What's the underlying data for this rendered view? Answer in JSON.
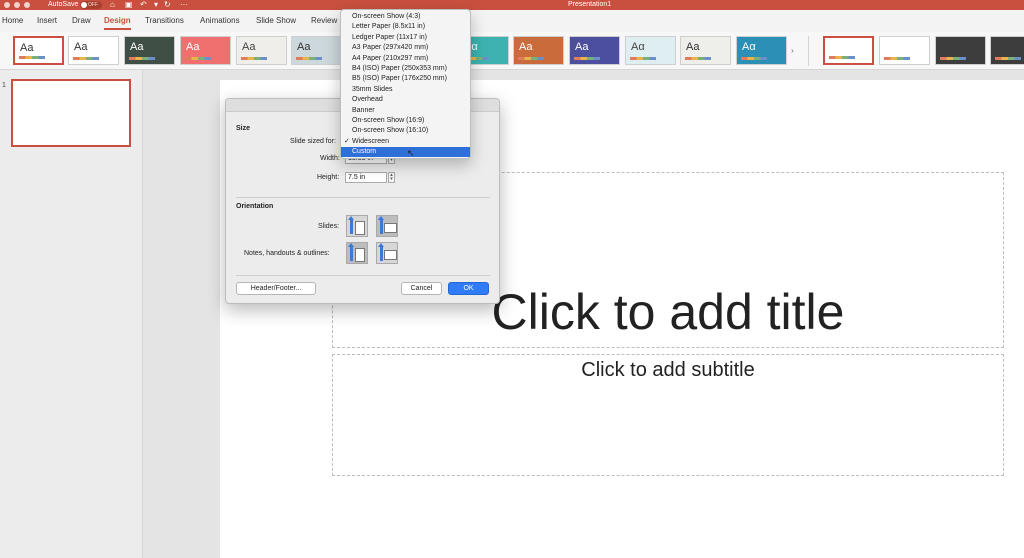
{
  "titlebar": {
    "autosave_label": "AutoSave",
    "autosave_state": "OFF",
    "doc_title": "Presentation1",
    "icons": [
      "home-icon",
      "save-icon",
      "undo-icon",
      "redo-icon",
      "more-icon"
    ]
  },
  "ribbon_tabs": [
    "Home",
    "Insert",
    "Draw",
    "Design",
    "Transitions",
    "Animations",
    "Slide Show",
    "Review"
  ],
  "active_tab": "Design",
  "themes": [
    {
      "label": "Aa",
      "bg": "#ffffff",
      "fg": "#333333",
      "selected": true
    },
    {
      "label": "Aa",
      "bg": "#ffffff",
      "fg": "#333333"
    },
    {
      "label": "Aa",
      "bg": "#3f4f45",
      "fg": "#ffffff"
    },
    {
      "label": "Aa",
      "bg": "#f07070",
      "fg": "#ffffff"
    },
    {
      "label": "Aa",
      "bg": "#efeeea",
      "fg": "#444444"
    },
    {
      "label": "Aa",
      "bg": "#cdd8dc",
      "fg": "#333333"
    },
    {
      "label": "Aα",
      "bg": "#3cb3b0",
      "fg": "#ffffff"
    },
    {
      "label": "Aa",
      "bg": "#c96b3b",
      "fg": "#ffffff"
    },
    {
      "label": "Aa",
      "bg": "#4c4f9e",
      "fg": "#ffffff"
    },
    {
      "label": "Aα",
      "bg": "#dfeef0",
      "fg": "#444444"
    },
    {
      "label": "Aa",
      "bg": "#eeeeea",
      "fg": "#333333"
    },
    {
      "label": "Aα",
      "bg": "#2c8fb5",
      "fg": "#ffffff"
    }
  ],
  "variants": [
    {
      "bg": "#ffffff"
    },
    {
      "bg": "#ffffff"
    },
    {
      "bg": "#3d3d3d"
    },
    {
      "bg": "#3d3d3d"
    }
  ],
  "thumbnails": {
    "slide_number": "1"
  },
  "slide": {
    "title_placeholder": "Click to add title",
    "subtitle_placeholder": "Click to add subtitle"
  },
  "dialog": {
    "size_heading": "Size",
    "slide_sized_for_label": "Slide sized for:",
    "width_label": "Width:",
    "width_value": "13.33 in",
    "height_label": "Height:",
    "height_value": "7.5 in",
    "orientation_heading": "Orientation",
    "slides_label": "Slides:",
    "notes_label": "Notes, handouts & outlines:",
    "header_footer_label": "Header/Footer...",
    "cancel_label": "Cancel",
    "ok_label": "OK"
  },
  "menu": {
    "items": [
      "On-screen Show (4:3)",
      "Letter Paper (8.5x11 in)",
      "Ledger Paper (11x17 in)",
      "A3 Paper (297x420 mm)",
      "A4 Paper (210x297 mm)",
      "B4 (ISO) Paper (250x353 mm)",
      "B5 (ISO) Paper (176x250 mm)",
      "35mm Slides",
      "Overhead",
      "Banner",
      "On-screen Show (16:9)",
      "On-screen Show (16:10)",
      "Widescreen",
      "Custom"
    ],
    "checked_index": 12,
    "highlighted_index": 13
  },
  "colors": {
    "accent": "#c9503e",
    "highlight": "#2f6fd8",
    "primary_button": "#2f7cf6"
  }
}
